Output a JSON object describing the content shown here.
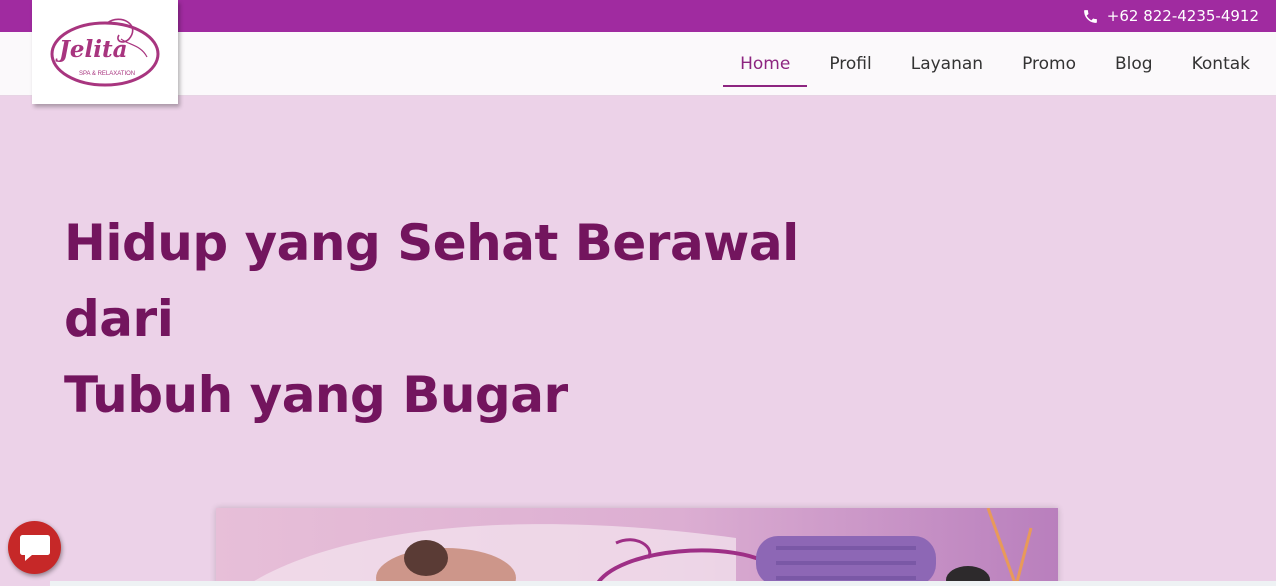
{
  "topbar": {
    "phone_icon": "phone-icon",
    "phone": "+62 822-4235-4912"
  },
  "logo": {
    "wordmark": "Jelita",
    "tagline": "SPA & RELAXATION"
  },
  "nav": {
    "items": [
      {
        "label": "Home",
        "active": true
      },
      {
        "label": "Profil",
        "active": false
      },
      {
        "label": "Layanan",
        "active": false
      },
      {
        "label": "Promo",
        "active": false
      },
      {
        "label": "Blog",
        "active": false
      },
      {
        "label": "Kontak",
        "active": false
      }
    ]
  },
  "hero": {
    "title_line1": "Hidup yang Sehat Berawal dari",
    "title_line2": "Tubuh yang Bugar"
  },
  "chat": {
    "icon": "chat-bubble-icon"
  },
  "colors": {
    "topbar": "#a02ba0",
    "hero_bg": "#ecd2e8",
    "title": "#73155e",
    "nav_active": "#8d2580",
    "chat": "#c62828"
  }
}
